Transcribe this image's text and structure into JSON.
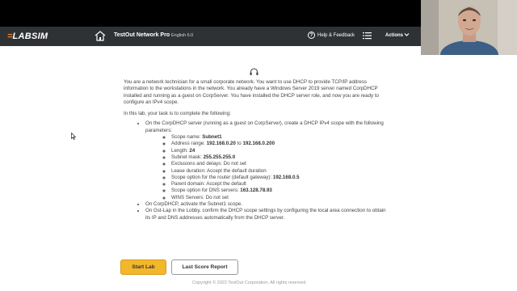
{
  "nav": {
    "logo_mark": "=",
    "logo_text": "LABSIM",
    "course_title": "TestOut Network Pro",
    "course_version": "English 6.0",
    "help_label": "Help & Feedback",
    "actions_label": "Actions"
  },
  "icons": {
    "home": "home-icon",
    "help": "question-circle-icon",
    "menu": "list-icon",
    "headset": "headset-icon"
  },
  "lab": {
    "intro": "You are a network technician for a small corporate network. You want to use DHCP to provide TCP/IP address information to the workstations in the network. You already have a Windows Server 2019 server named CorpDHCP installed and running as a guest on CorpServer. You have installed the DHCP server role, and now you are ready to configure an IPv4 scope.",
    "task_lead": "In this lab, your task is to complete the following:",
    "task1": "On the CorpDHCP server (running as a guest on CorpServer), create a DHCP IPv4 scope with the following parameters:",
    "params": {
      "scope_name_label": "Scope name: ",
      "scope_name_value": "Subnet1",
      "range_label": "Address range: ",
      "range_start": "192.168.0.20",
      "range_to": " to ",
      "range_end": "192.168.0.200",
      "length_label": "Length: ",
      "length_value": "24",
      "mask_label": "Subnet mask: ",
      "mask_value": "255.255.255.0",
      "exclusions": "Exclusions and delays: Do not set",
      "lease": "Lease duration: Accept the default duration",
      "router_label": "Scope option for the router (default gateway): ",
      "router_value": "192.168.0.5",
      "parent": "Parent domain: Accept the default",
      "dns_label": "Scope option for DNS servers: ",
      "dns_value": "163.128.78.93",
      "wins": "WINS Servers: Do not set"
    },
    "task2": "On CorpDHCP, activate the Subnet1 scope.",
    "task3": "On Gst-Lap in the Lobby, confirm the DHCP scope settings by configuring the local area connection to obtain its IP and DNS addresses automatically from the DHCP server."
  },
  "buttons": {
    "start": "Start Lab",
    "score": "Last Score Report"
  },
  "footer": {
    "copyright": "Copyright © 2022 TestOut Corporation. All rights reserved."
  },
  "colors": {
    "nav_bg": "#2f3235",
    "accent": "#f2b72b",
    "logo_accent": "#e9832b"
  }
}
